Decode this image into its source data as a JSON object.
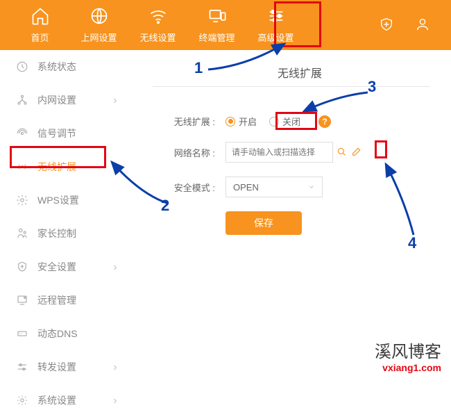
{
  "topnav": {
    "items": [
      {
        "label": "首页"
      },
      {
        "label": "上网设置"
      },
      {
        "label": "无线设置"
      },
      {
        "label": "终端管理"
      },
      {
        "label": "高级设置"
      }
    ]
  },
  "sidebar": {
    "items": [
      {
        "label": "系统状态"
      },
      {
        "label": "内网设置"
      },
      {
        "label": "信号调节"
      },
      {
        "label": "无线扩展"
      },
      {
        "label": "WPS设置"
      },
      {
        "label": "家长控制"
      },
      {
        "label": "安全设置"
      },
      {
        "label": "远程管理"
      },
      {
        "label": "动态DNS"
      },
      {
        "label": "转发设置"
      },
      {
        "label": "系统设置"
      }
    ]
  },
  "main": {
    "title": "无线扩展",
    "field_wds_label": "无线扩展 :",
    "radio_on": "开启",
    "radio_off": "关闭",
    "field_ssid_label": "网络名称 :",
    "ssid_placeholder": "请手动输入或扫描选择",
    "field_mode_label": "安全模式 :",
    "mode_value": "OPEN",
    "save_label": "保存"
  },
  "annotations": {
    "n1": "1",
    "n2": "2",
    "n3": "3",
    "n4": "4"
  },
  "watermark": {
    "line1": "溪风博客",
    "line2": "vxiang1.com"
  }
}
